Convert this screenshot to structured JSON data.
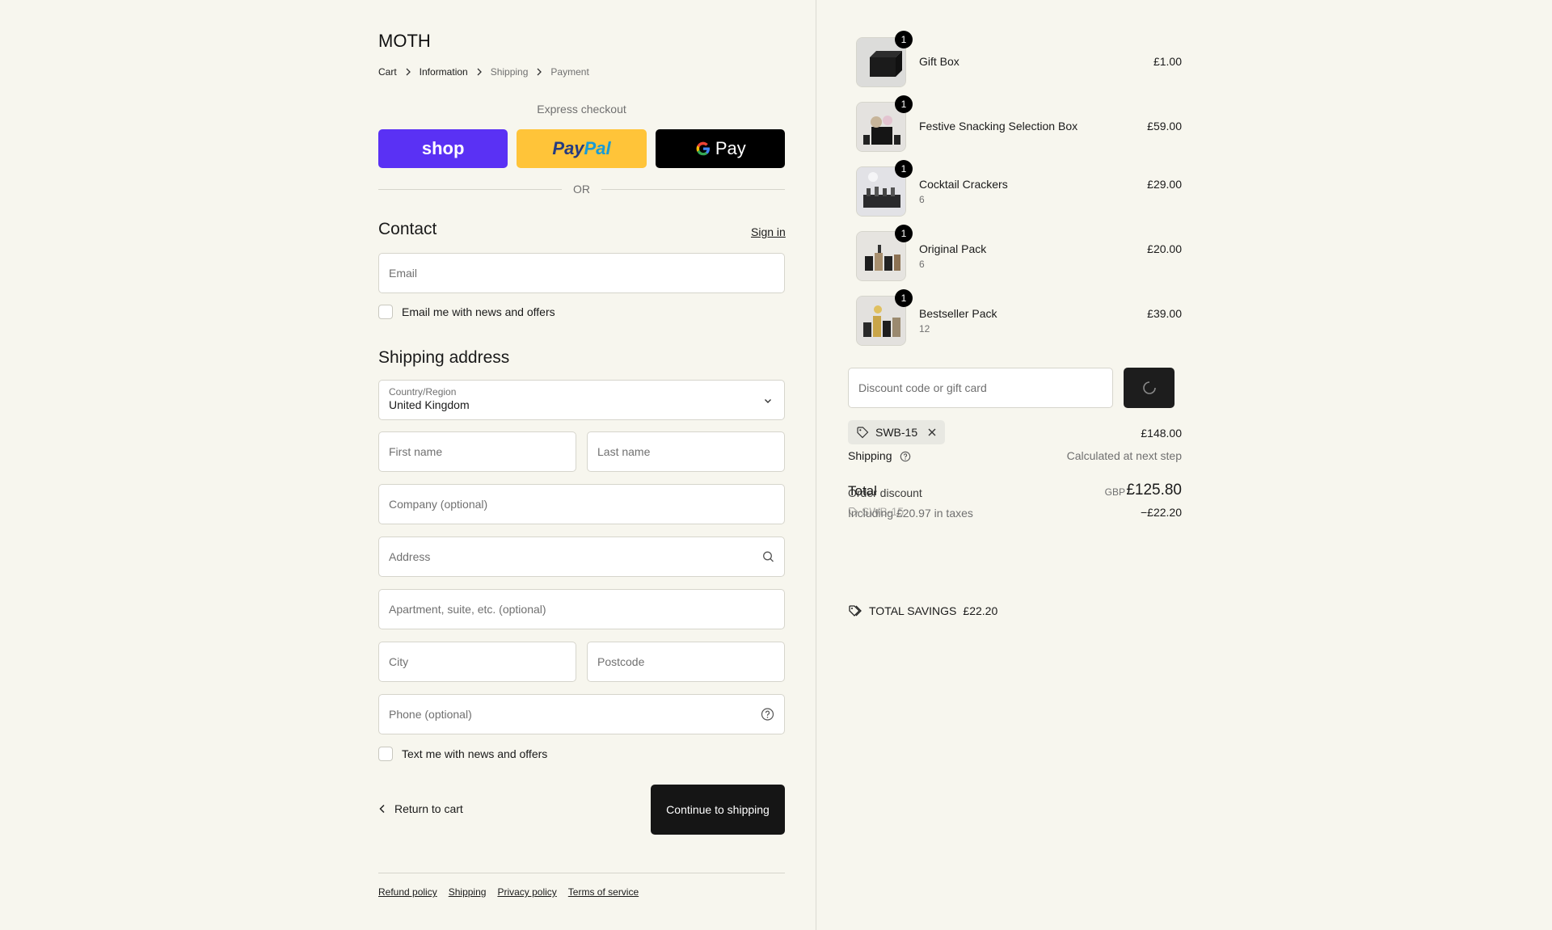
{
  "brand": "MOTH",
  "breadcrumb": [
    "Cart",
    "Information",
    "Shipping",
    "Payment"
  ],
  "express_label": "Express checkout",
  "express_buttons": {
    "shop": "shop",
    "paypal": "PayPal",
    "gpay": "Pay"
  },
  "or_label": "OR",
  "contact": {
    "title": "Contact",
    "signin": "Sign in",
    "email_placeholder": "Email",
    "news_label": "Email me with news and offers"
  },
  "shipping_address": {
    "title": "Shipping address",
    "country_label": "Country/Region",
    "country_value": "United Kingdom",
    "first_name": "First name",
    "last_name": "Last name",
    "company": "Company (optional)",
    "address": "Address",
    "apartment": "Apartment, suite, etc. (optional)",
    "city": "City",
    "postcode": "Postcode",
    "phone": "Phone (optional)",
    "text_label": "Text me with news and offers"
  },
  "actions": {
    "return": "Return to cart",
    "continue": "Continue to shipping"
  },
  "footer_links": [
    "Refund policy",
    "Shipping",
    "Privacy policy",
    "Terms of service"
  ],
  "order_items": [
    {
      "name": "Gift Box",
      "variant": "",
      "price": "£1.00",
      "qty": "1"
    },
    {
      "name": "Festive Snacking Selection Box",
      "variant": "",
      "price": "£59.00",
      "qty": "1"
    },
    {
      "name": "Cocktail Crackers",
      "variant": "6",
      "price": "£29.00",
      "qty": "1"
    },
    {
      "name": "Original Pack",
      "variant": "6",
      "price": "£20.00",
      "qty": "1"
    },
    {
      "name": "Bestseller Pack",
      "variant": "12",
      "price": "£39.00",
      "qty": "1"
    }
  ],
  "discount": {
    "placeholder": "Discount code or gift card",
    "code": "SWB-15"
  },
  "summary": {
    "subtotal": "£148.00",
    "shipping_label": "Shipping",
    "shipping_value": "Calculated at next step",
    "total_label": "Total",
    "currency": "GBP",
    "total_value": "£125.80",
    "taxes": "Including £20.97 in taxes",
    "order_discount_label": "Order discount",
    "order_discount_code": "SWB-15",
    "order_discount_value": "−£22.20",
    "savings_label": "TOTAL SAVINGS",
    "savings_value": "£22.20"
  }
}
